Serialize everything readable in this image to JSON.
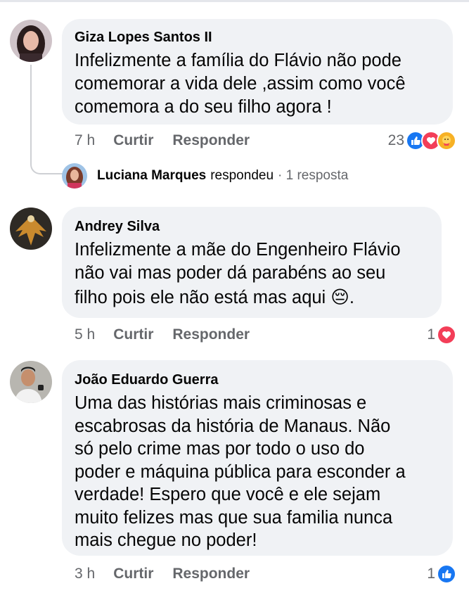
{
  "comments": [
    {
      "author": "Giza Lopes Santos II",
      "lines": [
        "Infelizmente a família do Flávio não pode",
        "comemorar a vida dele ,assim como você",
        "comemora a do seu filho agora !"
      ],
      "time": "7 h",
      "like": "Curtir",
      "reply": "Responder",
      "reaction_count": "23",
      "reactions": [
        "like-icon",
        "love-icon",
        "care-icon"
      ]
    },
    {
      "author": "Andrey Silva",
      "lines": [
        "Infelizmente a mãe do Engenheiro Flávio",
        "não vai mas poder dá parabéns ao seu",
        "filho pois ele não está mas aqui 😔."
      ],
      "time": "5 h",
      "like": "Curtir",
      "reply": "Responder",
      "reaction_count": "1",
      "reactions": [
        "love-icon"
      ]
    },
    {
      "author": "João Eduardo Guerra",
      "lines": [
        "Uma das histórias mais criminosas e",
        "escabrosas da história de Manaus. Não",
        "só pelo crime mas por todo o uso do",
        "poder e máquina pública para esconder a",
        "verdade! Espero que você e ele sejam",
        "muito felizes mas que sua familia nunca",
        "mais chegue no poder!"
      ],
      "time": "3 h",
      "like": "Curtir",
      "reply": "Responder",
      "reaction_count": "1",
      "reactions": [
        "like-icon"
      ]
    }
  ],
  "reply_summary": {
    "name": "Luciana Marques",
    "action": "respondeu",
    "count": "· 1 resposta"
  },
  "colors": {
    "like": "#1877f2",
    "love": "#f33e58",
    "care": "#f7b125",
    "bubble": "#f0f2f5",
    "meta": "#65676b"
  }
}
